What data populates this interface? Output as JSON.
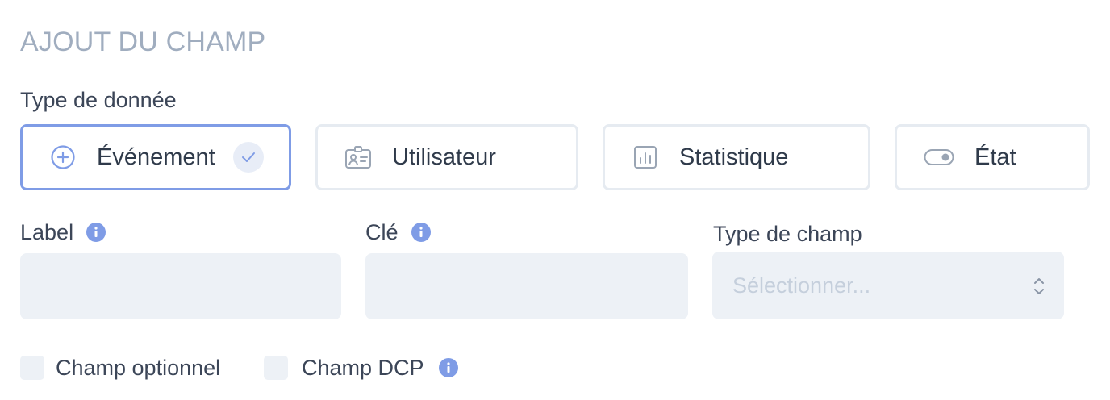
{
  "section": {
    "title": "AJOUT DU CHAMP"
  },
  "data_type": {
    "label": "Type de donnée",
    "options": [
      {
        "label": "Événement",
        "icon": "plus-circle-icon",
        "selected": true
      },
      {
        "label": "Utilisateur",
        "icon": "user-id-card-icon",
        "selected": false
      },
      {
        "label": "Statistique",
        "icon": "bar-chart-icon",
        "selected": false
      },
      {
        "label": "État",
        "icon": "toggle-icon",
        "selected": false
      }
    ]
  },
  "fields": {
    "label": {
      "label": "Label",
      "value": "",
      "placeholder": ""
    },
    "key": {
      "label": "Clé",
      "value": "",
      "placeholder": ""
    },
    "field_type": {
      "label": "Type de champ",
      "placeholder": "Sélectionner..."
    }
  },
  "checkboxes": {
    "optional": {
      "label": "Champ optionnel",
      "checked": false
    },
    "dcp": {
      "label": "Champ DCP",
      "checked": false
    }
  },
  "colors": {
    "accent": "#7f9ce6",
    "info": "#7f9ce6",
    "title": "#a0adbf",
    "text": "#3c4658",
    "input_bg": "#edf1f6",
    "card_border": "#e6ebf1"
  }
}
